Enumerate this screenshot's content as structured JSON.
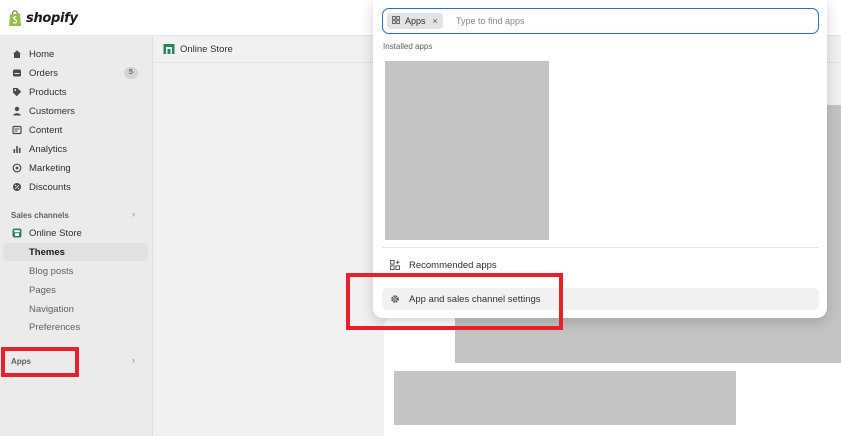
{
  "app": {
    "logo_text": "shopify"
  },
  "sidebar": {
    "items": [
      {
        "label": "Home",
        "icon": "home-icon"
      },
      {
        "label": "Orders",
        "icon": "orders-icon",
        "badge": "5"
      },
      {
        "label": "Products",
        "icon": "tag-icon"
      },
      {
        "label": "Customers",
        "icon": "person-icon"
      },
      {
        "label": "Content",
        "icon": "content-icon"
      },
      {
        "label": "Analytics",
        "icon": "bar-chart-icon"
      },
      {
        "label": "Marketing",
        "icon": "target-icon"
      },
      {
        "label": "Discounts",
        "icon": "discount-icon"
      }
    ],
    "sales_channels_label": "Sales channels",
    "online_store_label": "Online Store",
    "sub_items": [
      "Themes",
      "Blog posts",
      "Pages",
      "Navigation",
      "Preferences"
    ],
    "active_sub_item": "Themes",
    "apps_label": "Apps"
  },
  "main": {
    "header_title": "Online Store"
  },
  "dropdown": {
    "chip_label": "Apps",
    "search_placeholder": "Type to find apps",
    "installed_label": "Installed apps",
    "recommended_label": "Recommended apps",
    "settings_label": "App and sales channel settings"
  },
  "colors": {
    "accent_blue": "#2c6ecb",
    "annotation_red": "#e8202a",
    "store_green": "#29845a"
  }
}
